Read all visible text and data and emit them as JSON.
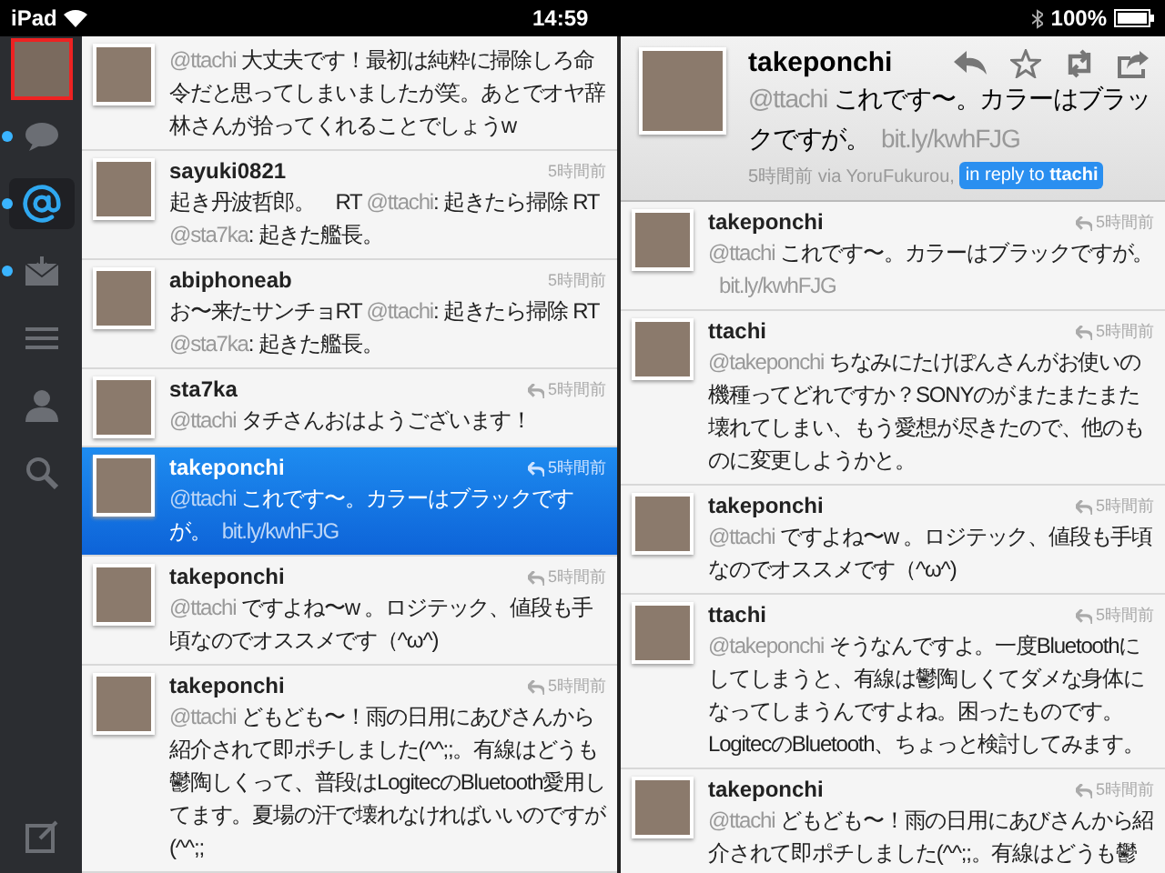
{
  "status_bar": {
    "device": "iPad",
    "time": "14:59",
    "battery": "100%"
  },
  "sidebar": {
    "items": [
      {
        "kind": "account",
        "selected": false,
        "unread": false
      },
      {
        "kind": "timeline",
        "selected": false,
        "unread": true
      },
      {
        "kind": "mentions",
        "selected": true,
        "unread": true
      },
      {
        "kind": "messages",
        "selected": false,
        "unread": true
      },
      {
        "kind": "lists",
        "selected": false,
        "unread": false
      },
      {
        "kind": "profile",
        "selected": false,
        "unread": false
      },
      {
        "kind": "search",
        "selected": false,
        "unread": false
      },
      {
        "kind": "compose",
        "selected": false,
        "unread": false
      }
    ]
  },
  "timeline": {
    "tweets": [
      {
        "selected": false,
        "parts": [
          {
            "kind": "mention",
            "text": "@ttachi"
          },
          {
            "kind": "text",
            "text": " 大丈夫です！最初は純粋に掃除しろ命令だと思ってしまいましたが笑。あとでオヤ辞林さんが拾ってくれることでしょうw"
          }
        ]
      },
      {
        "user": "sayuki0821",
        "time": "5時間前",
        "replied": false,
        "selected": false,
        "parts": [
          {
            "kind": "text",
            "text": "起き丹波哲郎。　RT "
          },
          {
            "kind": "mention",
            "text": "@ttachi"
          },
          {
            "kind": "text",
            "text": ": 起きたら掃除 RT "
          },
          {
            "kind": "mention",
            "text": "@sta7ka"
          },
          {
            "kind": "text",
            "text": ": 起きた艦長。"
          }
        ]
      },
      {
        "user": "abiphoneab",
        "time": "5時間前",
        "replied": false,
        "selected": false,
        "parts": [
          {
            "kind": "text",
            "text": "お〜来たサンチョRT "
          },
          {
            "kind": "mention",
            "text": "@ttachi"
          },
          {
            "kind": "text",
            "text": ": 起きたら掃除 RT "
          },
          {
            "kind": "mention",
            "text": "@sta7ka"
          },
          {
            "kind": "text",
            "text": ": 起きた艦長。"
          }
        ]
      },
      {
        "user": "sta7ka",
        "time": "5時間前",
        "replied": true,
        "selected": false,
        "parts": [
          {
            "kind": "mention",
            "text": "@ttachi"
          },
          {
            "kind": "text",
            "text": " タチさんおはようございます！"
          }
        ]
      },
      {
        "user": "takeponchi",
        "time": "5時間前",
        "replied": true,
        "selected": true,
        "parts": [
          {
            "kind": "mention",
            "text": "@ttachi"
          },
          {
            "kind": "text",
            "text": " これです〜。カラーはブラックですが。"
          },
          {
            "kind": "link",
            "text": "bit.ly/kwhFJG"
          }
        ]
      },
      {
        "user": "takeponchi",
        "time": "5時間前",
        "replied": true,
        "selected": false,
        "parts": [
          {
            "kind": "mention",
            "text": "@ttachi"
          },
          {
            "kind": "text",
            "text": " ですよね〜w 。ロジテック、値段も手頃なのでオススメです（^ω^)"
          }
        ]
      },
      {
        "user": "takeponchi",
        "time": "5時間前",
        "replied": true,
        "selected": false,
        "parts": [
          {
            "kind": "mention",
            "text": "@ttachi"
          },
          {
            "kind": "text",
            "text": " どもども〜！雨の日用にあびさんから紹介されて即ポチしました(^^;;。有線はどうも鬱陶しくって、普段はLogitecのBluetooth愛用してます。夏場の汗で壊れなければいいのですが(^^;;"
          }
        ]
      }
    ]
  },
  "detail": {
    "user": "takeponchi",
    "parts": [
      {
        "kind": "mention",
        "text": "@ttachi"
      },
      {
        "kind": "text",
        "text": " これです〜。カラーはブラックですが。"
      },
      {
        "kind": "link",
        "text": "bit.ly/kwhFJG"
      }
    ],
    "time": "5時間前",
    "via": "via",
    "client": "YoruFukurou,",
    "reply_prefix": "in reply to",
    "reply_user": "ttachi",
    "actions": [
      {
        "kind": "reply"
      },
      {
        "kind": "favorite"
      },
      {
        "kind": "retweet"
      },
      {
        "kind": "share"
      }
    ],
    "conversation": [
      {
        "user": "takeponchi",
        "time": "5時間前",
        "replied": true,
        "selected": false,
        "parts": [
          {
            "kind": "mention",
            "text": "@ttachi"
          },
          {
            "kind": "text",
            "text": " これです〜。カラーはブラックですが。"
          },
          {
            "kind": "link",
            "text": "bit.ly/kwhFJG"
          }
        ]
      },
      {
        "user": "ttachi",
        "time": "5時間前",
        "replied": true,
        "selected": false,
        "parts": [
          {
            "kind": "mention",
            "text": "@takeponchi"
          },
          {
            "kind": "text",
            "text": " ちなみにたけぽんさんがお使いの機種ってどれですか？SONYのがまたまたまた壊れてしまい、もう愛想が尽きたので、他のものに変更しようかと。"
          }
        ]
      },
      {
        "user": "takeponchi",
        "time": "5時間前",
        "replied": true,
        "selected": false,
        "parts": [
          {
            "kind": "mention",
            "text": "@ttachi"
          },
          {
            "kind": "text",
            "text": " ですよね〜w 。ロジテック、値段も手頃なのでオススメです（^ω^)"
          }
        ]
      },
      {
        "user": "ttachi",
        "time": "5時間前",
        "replied": true,
        "selected": false,
        "parts": [
          {
            "kind": "mention",
            "text": "@takeponchi"
          },
          {
            "kind": "text",
            "text": " そうなんですよ。一度Bluetoothにしてしまうと、有線は鬱陶しくてダメな身体になってしまうんですよね。困ったものです。LogitecのBluetooth、ちょっと検討してみます。"
          }
        ]
      },
      {
        "user": "takeponchi",
        "time": "5時間前",
        "replied": true,
        "selected": false,
        "parts": [
          {
            "kind": "mention",
            "text": "@ttachi"
          },
          {
            "kind": "text",
            "text": " どもども〜！雨の日用にあびさんから紹介されて即ポチしました(^^;;。有線はどうも鬱"
          }
        ]
      }
    ]
  }
}
